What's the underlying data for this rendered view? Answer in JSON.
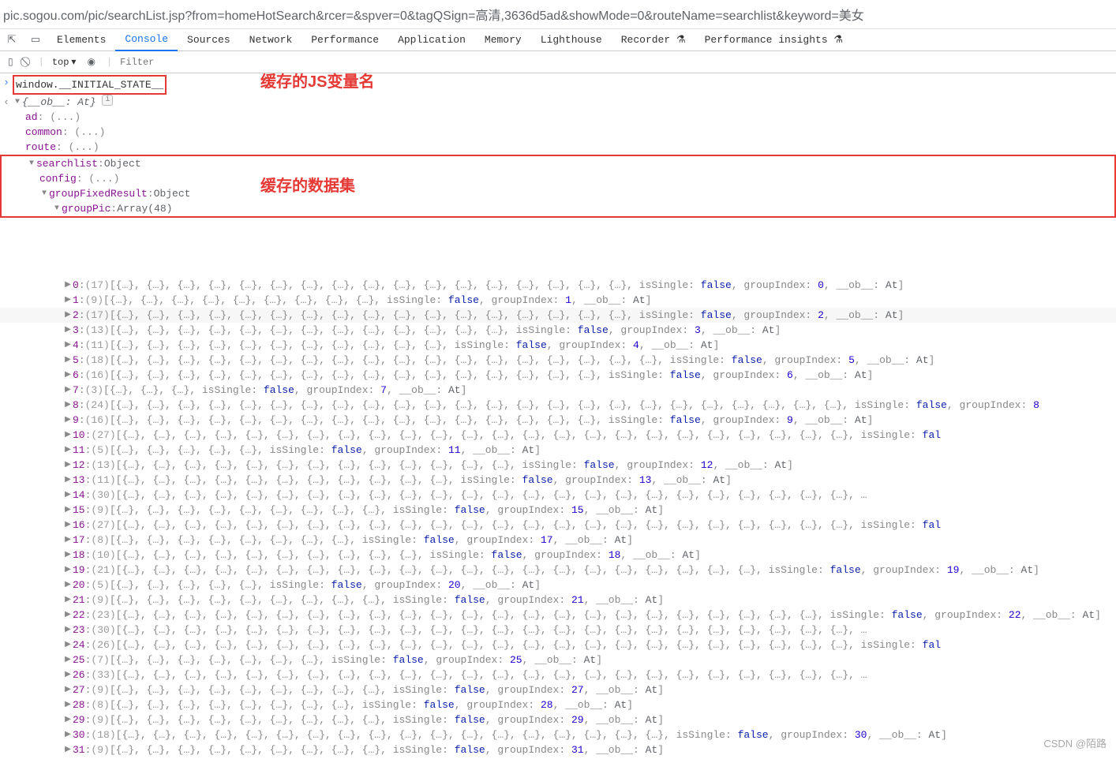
{
  "url": "pic.sogou.com/pic/searchList.jsp?from=homeHotSearch&rcer=&spver=0&tagQSign=高清,3636d5ad&showMode=0&routeName=searchlist&keyword=美女",
  "tabs": [
    "Elements",
    "Console",
    "Sources",
    "Network",
    "Performance",
    "Application",
    "Memory",
    "Lighthouse",
    "Recorder ⚗",
    "Performance insights ⚗"
  ],
  "active_tab": "Console",
  "toolbar": {
    "scope": "top",
    "filter_placeholder": "Filter"
  },
  "console_input": "window.__INITIAL_STATE__",
  "annotations": {
    "varname": "缓存的JS变量名",
    "dataset": "缓存的数据集"
  },
  "root": {
    "summary": "{__ob__: At}",
    "props": [
      "ad",
      "common",
      "route"
    ],
    "searchlist": {
      "label": "searchlist",
      "type": "Object",
      "config": "config",
      "gfr": {
        "label": "groupFixedResult",
        "type": "Object"
      },
      "groupPic": {
        "label": "groupPic",
        "len": 48
      }
    }
  },
  "rows": [
    {
      "i": 0,
      "c": 17
    },
    {
      "i": 1,
      "c": 9
    },
    {
      "i": 2,
      "c": 17,
      "hover": true
    },
    {
      "i": 3,
      "c": 13
    },
    {
      "i": 4,
      "c": 11
    },
    {
      "i": 5,
      "c": 18
    },
    {
      "i": 6,
      "c": 16
    },
    {
      "i": 7,
      "c": 3
    },
    {
      "i": 8,
      "c": 24,
      "trunc": true
    },
    {
      "i": 9,
      "c": 16
    },
    {
      "i": 10,
      "c": 27,
      "open": true
    },
    {
      "i": 11,
      "c": 5
    },
    {
      "i": 12,
      "c": 13
    },
    {
      "i": 13,
      "c": 11
    },
    {
      "i": 14,
      "c": 30,
      "open": true
    },
    {
      "i": 15,
      "c": 9
    },
    {
      "i": 16,
      "c": 27,
      "open": true
    },
    {
      "i": 17,
      "c": 8
    },
    {
      "i": 18,
      "c": 10
    },
    {
      "i": 19,
      "c": 21
    },
    {
      "i": 20,
      "c": 5
    },
    {
      "i": 21,
      "c": 9
    },
    {
      "i": 22,
      "c": 23
    },
    {
      "i": 23,
      "c": 30,
      "open": true
    },
    {
      "i": 24,
      "c": 26,
      "open": true
    },
    {
      "i": 25,
      "c": 7
    },
    {
      "i": 26,
      "c": 33,
      "open": true
    },
    {
      "i": 27,
      "c": 9
    },
    {
      "i": 28,
      "c": 8
    },
    {
      "i": 29,
      "c": 9
    },
    {
      "i": 30,
      "c": 18
    },
    {
      "i": 31,
      "c": 9
    }
  ],
  "labels": {
    "isSingle": "isSingle",
    "groupIndex": "groupIndex",
    "ob": "__ob__",
    "at": "At",
    "false": "false"
  },
  "watermark": "CSDN @陌路"
}
